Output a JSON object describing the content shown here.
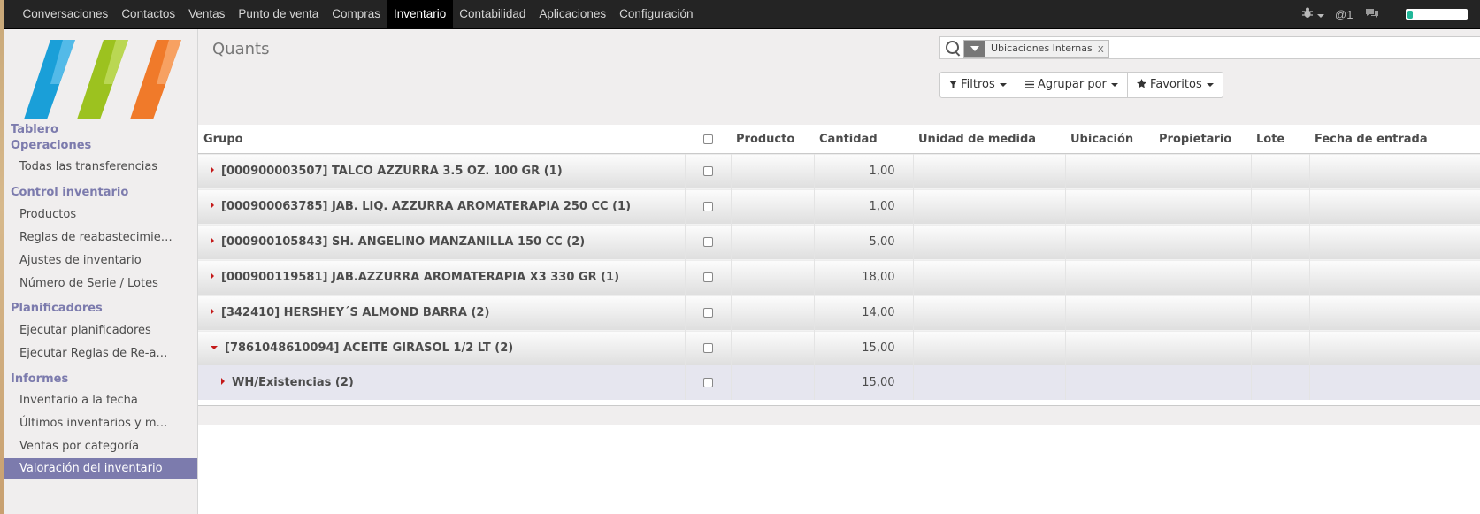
{
  "nav": {
    "menu": [
      "Conversaciones",
      "Contactos",
      "Ventas",
      "Punto de venta",
      "Compras",
      "Inventario",
      "Contabilidad",
      "Aplicaciones",
      "Configuración"
    ],
    "active": "Inventario",
    "mentions": "@1",
    "icons": [
      "bug-icon",
      "chat-icon"
    ]
  },
  "sidebar": {
    "dashboard": "Tablero",
    "sections": [
      {
        "title": "Operaciones",
        "items": [
          "Todas las transferencias"
        ]
      },
      {
        "title": "Control inventario",
        "items": [
          "Productos",
          "Reglas de reabastecimie…",
          "Ajustes de inventario",
          "Número de Serie / Lotes"
        ]
      },
      {
        "title": "Planificadores",
        "items": [
          "Ejecutar planificadores",
          "Ejecutar Reglas de Re-a…"
        ]
      },
      {
        "title": "Informes",
        "items": [
          "Inventario a la fecha",
          "Últimos inventarios y m…",
          "Ventas por categoría",
          "Valoración del inventario"
        ]
      }
    ],
    "active_item": "Valoración del inventario"
  },
  "control": {
    "title": "Quants",
    "facet": "Ubicaciones Internas",
    "facet_remove": "x",
    "buttons": {
      "filters": "Filtros",
      "group_by": "Agrupar por",
      "favorites": "Favoritos"
    }
  },
  "table": {
    "headers": {
      "group": "Grupo",
      "product": "Producto",
      "quantity": "Cantidad",
      "uom": "Unidad de medida",
      "location": "Ubicación",
      "owner": "Propietario",
      "lot": "Lote",
      "date": "Fecha de entrada"
    },
    "rows": [
      {
        "label": "[000900003507] TALCO AZZURRA 3.5 OZ. 100 GR (1)",
        "qty": "1,00",
        "expanded": false,
        "level": 0
      },
      {
        "label": "[000900063785] JAB. LIQ. AZZURRA AROMATERAPIA 250 CC (1)",
        "qty": "1,00",
        "expanded": false,
        "level": 0
      },
      {
        "label": "[000900105843] SH. ANGELINO MANZANILLA 150 CC (2)",
        "qty": "5,00",
        "expanded": false,
        "level": 0
      },
      {
        "label": "[000900119581] JAB.AZZURRA AROMATERAPIA X3 330 GR (1)",
        "qty": "18,00",
        "expanded": false,
        "level": 0
      },
      {
        "label": "[342410] HERSHEY´S ALMOND BARRA (2)",
        "qty": "14,00",
        "expanded": false,
        "level": 0
      },
      {
        "label": "[7861048610094] ACEITE GIRASOL 1/2 LT (2)",
        "qty": "15,00",
        "expanded": true,
        "level": 0
      },
      {
        "label": "WH/Existencias (2)",
        "qty": "15,00",
        "expanded": false,
        "level": 1
      }
    ]
  },
  "colors": {
    "navbar": "#242424",
    "accent": "#7c7bad",
    "sidebar_bg": "#f0eeee",
    "caret": "#c41a1a"
  }
}
